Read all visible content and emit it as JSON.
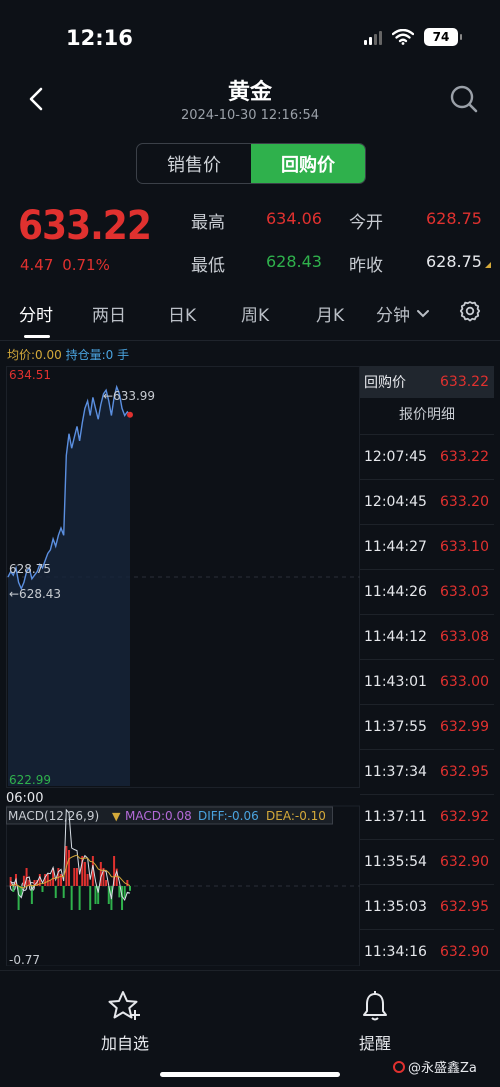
{
  "status_bar": {
    "time": "12:16",
    "battery": "74"
  },
  "header": {
    "title": "黄金",
    "datetime": "2024-10-30 12:16:54"
  },
  "price_toggle": {
    "sell_label": "销售价",
    "buyback_label": "回购价",
    "selected": "回购价"
  },
  "quote": {
    "price": "633.22",
    "change": "4.47",
    "change_pct": "0.71%",
    "high_label": "最高",
    "high": "634.06",
    "low_label": "最低",
    "low": "628.43",
    "open_label": "今开",
    "open": "628.75",
    "prev_close_label": "昨收",
    "prev_close": "628.75"
  },
  "tabs": [
    "分时",
    "两日",
    "日K",
    "周K",
    "月K",
    "分钟"
  ],
  "active_tab": "分时",
  "chart_info": {
    "avg_label": "均价:0.00",
    "position_label": "持仓量:0 手"
  },
  "chart": {
    "y_max": "634.51",
    "y_min": "622.99",
    "prev_close_label": "628.75",
    "high_marker": "←633.99",
    "low_marker": "←628.43",
    "start_time": "06:00",
    "macd_header": "MACD(12,26,9)",
    "macd_value": "MACD:0.08",
    "diff_value": "DIFF:-0.06",
    "dea_value": "DEA:-0.10",
    "macd_zero": "0.00",
    "macd_min": "-0.77"
  },
  "chart_data": {
    "type": "line",
    "y_range": [
      622.99,
      634.51
    ],
    "series": [
      {
        "values": [
          628.75,
          628.9,
          628.8,
          629.0,
          628.6,
          628.43,
          628.6,
          628.9,
          629.0,
          628.7,
          628.8,
          628.9,
          629.1,
          629.0,
          629.2,
          629.4,
          629.5,
          629.8,
          629.6,
          629.9,
          630.1,
          629.9,
          632.1,
          632.7,
          632.3,
          632.6,
          632.9,
          632.5,
          633.0,
          633.4,
          633.6,
          633.2,
          633.7,
          633.4,
          633.1,
          633.5,
          633.8,
          633.9,
          633.6,
          633.2,
          633.7,
          633.99,
          633.8,
          633.4,
          633.2,
          633.3,
          633.22
        ]
      }
    ]
  },
  "quote_list": {
    "header_label": "回购价",
    "header_price": "633.22",
    "subtitle": "报价明细",
    "rows": [
      {
        "time": "12:07:45",
        "price": "633.22"
      },
      {
        "time": "12:04:45",
        "price": "633.20"
      },
      {
        "time": "11:44:27",
        "price": "633.10"
      },
      {
        "time": "11:44:26",
        "price": "633.03"
      },
      {
        "time": "11:44:12",
        "price": "633.08"
      },
      {
        "time": "11:43:01",
        "price": "633.00"
      },
      {
        "time": "11:37:55",
        "price": "632.99"
      },
      {
        "time": "11:37:34",
        "price": "632.95"
      },
      {
        "time": "11:37:11",
        "price": "632.92"
      },
      {
        "time": "11:35:54",
        "price": "632.90"
      },
      {
        "time": "11:35:03",
        "price": "632.95"
      },
      {
        "time": "11:34:16",
        "price": "632.90"
      }
    ]
  },
  "bottom_bar": {
    "favorite_label": "加自选",
    "alert_label": "提醒",
    "watermark": "@永盛鑫Za"
  },
  "colors": {
    "up": "#e0312f",
    "down": "#2fb14c",
    "line": "#5b8fe0",
    "accent": "#2fb14c"
  }
}
